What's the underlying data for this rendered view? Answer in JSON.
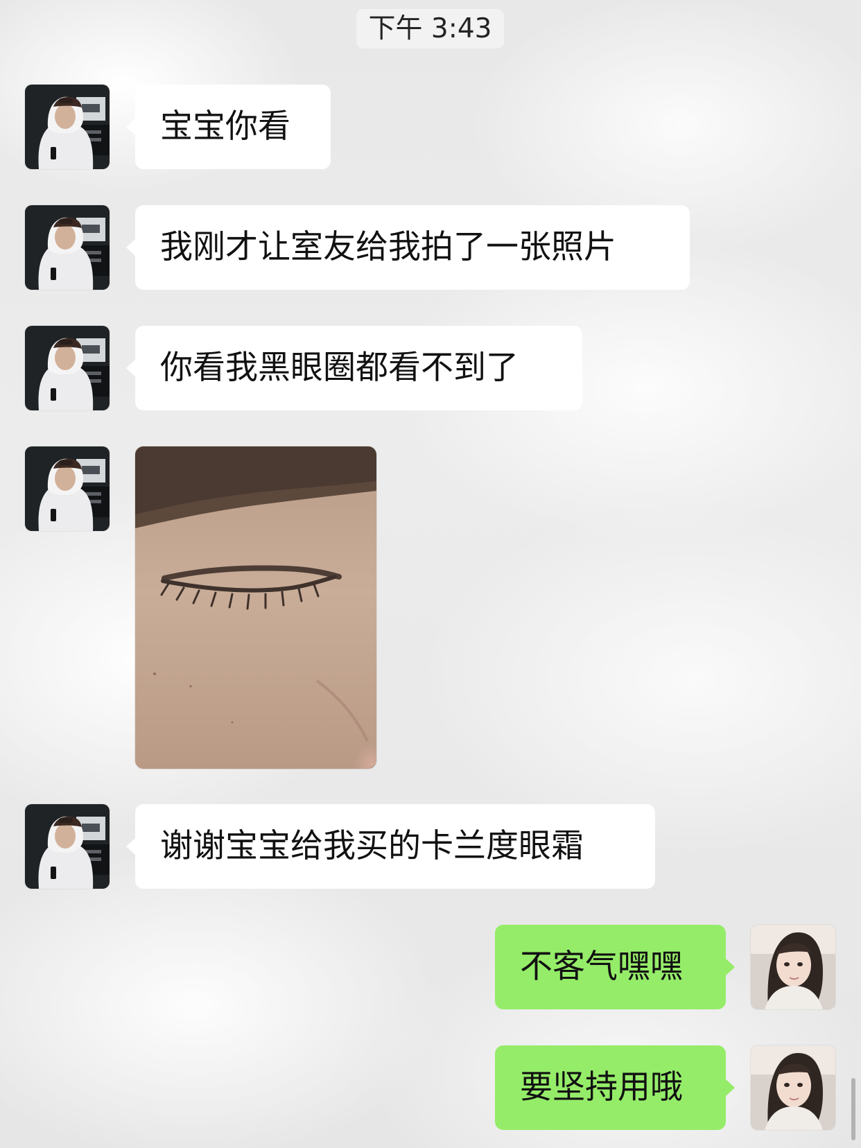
{
  "chat": {
    "timestamp": "下午 3:43",
    "messages": [
      {
        "sender": "incoming",
        "type": "text",
        "text": "宝宝你看",
        "avatar_icon": "contact-avatar-hoodie"
      },
      {
        "sender": "incoming",
        "type": "text",
        "text": "我刚才让室友给我拍了一张照片",
        "avatar_icon": "contact-avatar-hoodie"
      },
      {
        "sender": "incoming",
        "type": "text",
        "text": "你看我黑眼圈都看不到了",
        "avatar_icon": "contact-avatar-hoodie"
      },
      {
        "sender": "incoming",
        "type": "image",
        "image_description": "close-up photo of closed eye",
        "avatar_icon": "contact-avatar-hoodie"
      },
      {
        "sender": "incoming",
        "type": "text",
        "text": "谢谢宝宝给我买的卡兰度眼霜",
        "avatar_icon": "contact-avatar-hoodie"
      },
      {
        "sender": "outgoing",
        "type": "text",
        "text": "不客气嘿嘿",
        "avatar_icon": "user-avatar-girl"
      },
      {
        "sender": "outgoing",
        "type": "text",
        "text": "要坚持用哦",
        "avatar_icon": "user-avatar-girl"
      }
    ]
  },
  "colors": {
    "incoming_bubble": "#ffffff",
    "outgoing_bubble": "#95ec69",
    "text": "#111111",
    "timestamp_text": "#232323",
    "background": "#e9e9e9"
  }
}
